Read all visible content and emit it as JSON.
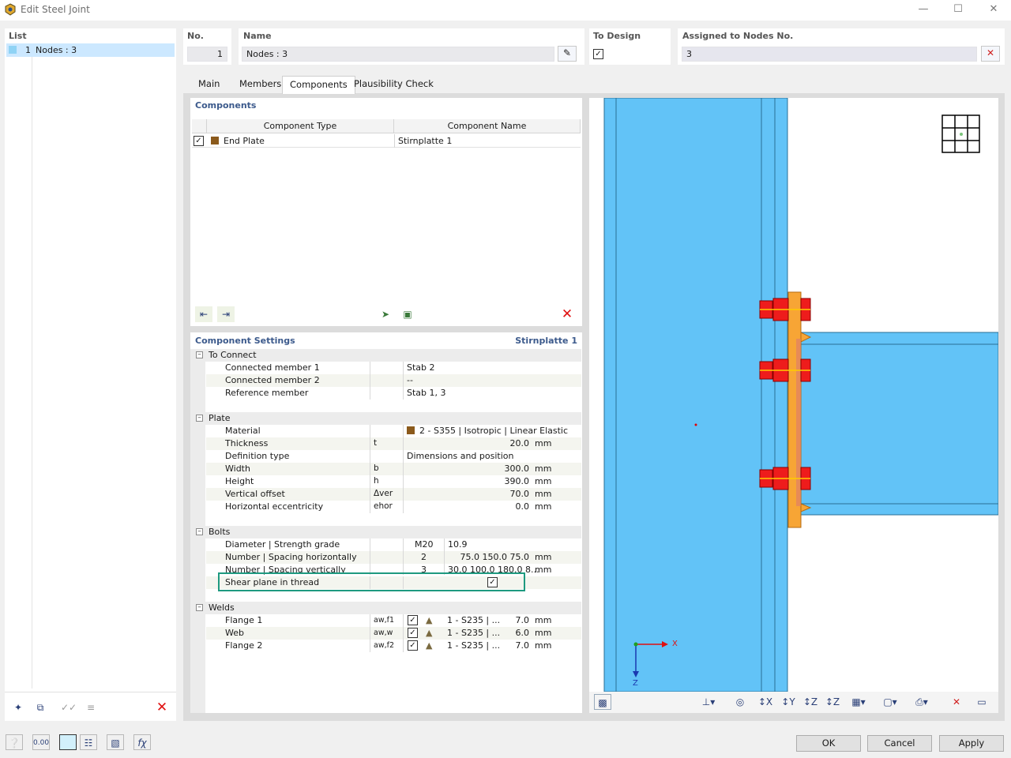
{
  "window": {
    "title": "Edit Steel Joint"
  },
  "list": {
    "header": "List",
    "items": [
      {
        "no": "1",
        "label": "Nodes : 3"
      }
    ]
  },
  "header": {
    "no_label": "No.",
    "no_value": "1",
    "name_label": "Name",
    "name_value": "Nodes : 3",
    "design_label": "To Design",
    "design_checked": true,
    "assigned_label": "Assigned to Nodes No.",
    "assigned_value": "3"
  },
  "tabs": [
    "Main",
    "Members",
    "Components",
    "Plausibility Check"
  ],
  "active_tab": "Components",
  "components": {
    "title": "Components",
    "col_type": "Component Type",
    "col_name": "Component Name",
    "rows": [
      {
        "checked": true,
        "type": "End Plate",
        "name": "Stirnplatte 1",
        "color": "#8b5a1c"
      }
    ]
  },
  "settings": {
    "title": "Component Settings",
    "subtitle": "Stirnplatte 1",
    "to_connect": {
      "label": "To Connect",
      "rows": [
        {
          "name": "Connected member 1",
          "value": "Stab 2"
        },
        {
          "name": "Connected member 2",
          "value": "--"
        },
        {
          "name": "Reference member",
          "value": "Stab 1, 3"
        }
      ]
    },
    "plate": {
      "label": "Plate",
      "material_name": "Material",
      "material_value": "2 - S355 | Isotropic | Linear Elastic",
      "thickness_name": "Thickness",
      "thickness_sym": "t",
      "thickness_val": "20.0",
      "thickness_unit": "mm",
      "deftype_name": "Definition type",
      "deftype_value": "Dimensions and position",
      "width_name": "Width",
      "width_sym": "b",
      "width_val": "300.0",
      "width_unit": "mm",
      "height_name": "Height",
      "height_sym": "h",
      "height_val": "390.0",
      "height_unit": "mm",
      "voff_name": "Vertical offset",
      "voff_sym": "Δver",
      "voff_val": "70.0",
      "voff_unit": "mm",
      "hecc_name": "Horizontal eccentricity",
      "hecc_sym": "ehor",
      "hecc_val": "0.0",
      "hecc_unit": "mm"
    },
    "bolts": {
      "label": "Bolts",
      "diam_name": "Diameter | Strength grade",
      "diam_val": "M20",
      "grade_val": "10.9",
      "nh_name": "Number | Spacing horizontally",
      "nh_count": "2",
      "nh_spacing": "75.0 150.0 75.0",
      "nh_unit": "mm",
      "nv_name": "Number | Spacing vertically",
      "nv_count": "3",
      "nv_spacing": "30.0 100.0 180.0 8...",
      "nv_unit": "mm",
      "shear_name": "Shear plane in thread",
      "shear_checked": true
    },
    "welds": {
      "label": "Welds",
      "rows": [
        {
          "name": "Flange 1",
          "sym": "aw,f1",
          "mat": "1 - S235 | ...",
          "val": "7.0",
          "unit": "mm"
        },
        {
          "name": "Web",
          "sym": "aw,w",
          "mat": "1 - S235 | ...",
          "val": "6.0",
          "unit": "mm"
        },
        {
          "name": "Flange 2",
          "sym": "aw,f2",
          "mat": "1 - S235 | ...",
          "val": "7.0",
          "unit": "mm"
        }
      ]
    }
  },
  "viewport": {
    "axis_x": "X",
    "axis_z": "Z",
    "steel_color": "#62c3f7",
    "plate_color": "#f7a535",
    "bolt_color": "#ee1c1c"
  },
  "buttons": {
    "ok": "OK",
    "cancel": "Cancel",
    "apply": "Apply"
  },
  "icons": {
    "list_toolbar": [
      "new-icon",
      "copy-icon",
      "check-all-icon",
      "uncheck-icon",
      "delete-icon"
    ],
    "bottom_toolbar": [
      "help-icon",
      "units-icon",
      "color-icon",
      "view-icon",
      "model-icon",
      "function-icon"
    ]
  }
}
